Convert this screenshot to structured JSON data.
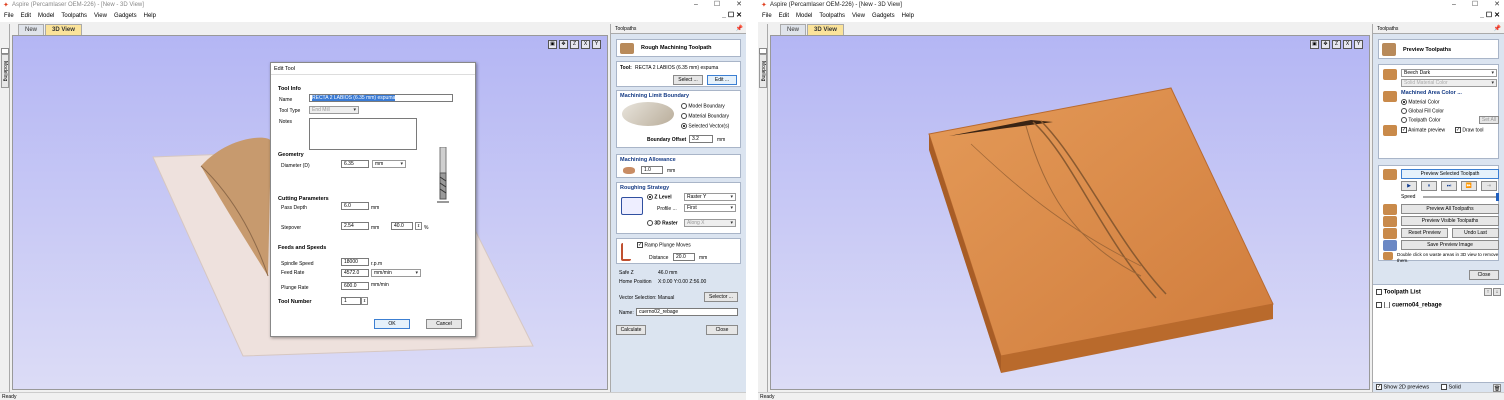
{
  "left": {
    "title": "Aspire (Percamlaser OEM-226) - [New - 3D View]",
    "menu": [
      "File",
      "Edit",
      "Model",
      "Toolpaths",
      "View",
      "Gadgets",
      "Help"
    ],
    "tabs": [
      "New",
      "3D View"
    ],
    "side_label": "Modeling",
    "status": "Ready",
    "panel": {
      "header": "Toolpaths",
      "toolpath_title": "Rough Machining Toolpath",
      "tool_label": "Tool:",
      "tool_name": "RECTA 2 LABIOS (6.35 mm) espuma",
      "select_btn": "Select ...",
      "edit_btn": "Edit ...",
      "mlb_title": "Machining Limit Boundary",
      "mlb_options": [
        "Model Boundary",
        "Material Boundary",
        "Selected Vector(s)"
      ],
      "boundary_offset_label": "Boundary Offset",
      "boundary_offset": "3.2",
      "unit": "mm",
      "allowance_title": "Machining Allowance",
      "allowance": "1.0",
      "strategy_title": "Roughing Strategy",
      "zlevel": "Z Level",
      "raster_value": "Raster Y",
      "profile_label": "Profile ...",
      "profile_value": "First",
      "raster3d": "3D Raster",
      "raster3d_value": "Along X",
      "ramp_label": "Ramp Plunge Moves",
      "distance_label": "Distance",
      "distance": "20.0",
      "safez_label": "Safe Z",
      "safez": "46.0 mm",
      "home_label": "Home Position",
      "home": "X:0.00 Y:0.00 Z:56.00",
      "vector_sel": "Vector Selection: Manual",
      "selector_btn": "Selector ...",
      "name_label": "Name:",
      "name_value": "cuerno02_rebage",
      "calculate_btn": "Calculate",
      "close_btn": "Close"
    },
    "dialog": {
      "title": "Edit Tool",
      "tool_info": "Tool Info",
      "name_label": "Name",
      "name_value": "RECTA 2 LABIOS (6.35 mm) espuma",
      "tooltype_label": "Tool Type",
      "tooltype_value": "End Mill",
      "notes_label": "Notes",
      "geometry": "Geometry",
      "diameter_label": "Diameter (D)",
      "diameter": "6.35",
      "diameter_unit": "mm",
      "cutting": "Cutting Parameters",
      "passdepth_label": "Pass Depth",
      "passdepth": "6.0",
      "stepover_label": "Stepover",
      "stepover": "2.54",
      "stepover_pct": "40.0",
      "pct": "%",
      "mm": "mm",
      "feeds": "Feeds and Speeds",
      "spindle_label": "Spindle Speed",
      "spindle": "18000",
      "rpm": "r.p.m",
      "feed_label": "Feed Rate",
      "feed": "4572.0",
      "feed_unit": "mm/min",
      "plunge_label": "Plunge Rate",
      "plunge": "600.0",
      "plunge_unit": "mm/min",
      "toolnum_label": "Tool Number",
      "toolnum": "1",
      "ok": "OK",
      "cancel": "Cancel"
    }
  },
  "right": {
    "title": "Aspire (Percamlaser OEM-226) - [New - 3D View]",
    "menu": [
      "File",
      "Edit",
      "Model",
      "Toolpaths",
      "View",
      "Gadgets",
      "Help"
    ],
    "tabs": [
      "New",
      "3D View"
    ],
    "side_label": "Modeling",
    "status": "Ready",
    "panel": {
      "header": "Toolpaths",
      "preview_title": "Preview Toolpaths",
      "material_value": "Beech Dark",
      "solid_color": "Solid Material Color",
      "machined_title": "Machined Area Color ...",
      "color_options": [
        "Material Color",
        "Global Fill Color",
        "Toolpath Color"
      ],
      "set_all": "Set All",
      "animate": "Animate preview",
      "draw_tool": "Draw tool",
      "preview_selected": "Preview Selected Toolpath",
      "speed": "Speed",
      "preview_all": "Preview All Toolpaths",
      "preview_visible": "Preview Visible Toolpaths",
      "reset_preview": "Reset Preview",
      "undo_last": "Undo Last",
      "save_image": "Save Preview Image",
      "hint": "Double click on waste areas in 3D view to remove them.",
      "close_btn": "Close",
      "list_title": "Toolpath List",
      "list_items": [
        "cuerno04_rebage"
      ],
      "show2d": "Show 2D previews",
      "solid": "Solid"
    }
  },
  "colors": {
    "accent": "#fbe39a",
    "view_bg": "#b4b6f4",
    "panel_bg": "#dbe4f0",
    "wood": "#d98a4a"
  }
}
